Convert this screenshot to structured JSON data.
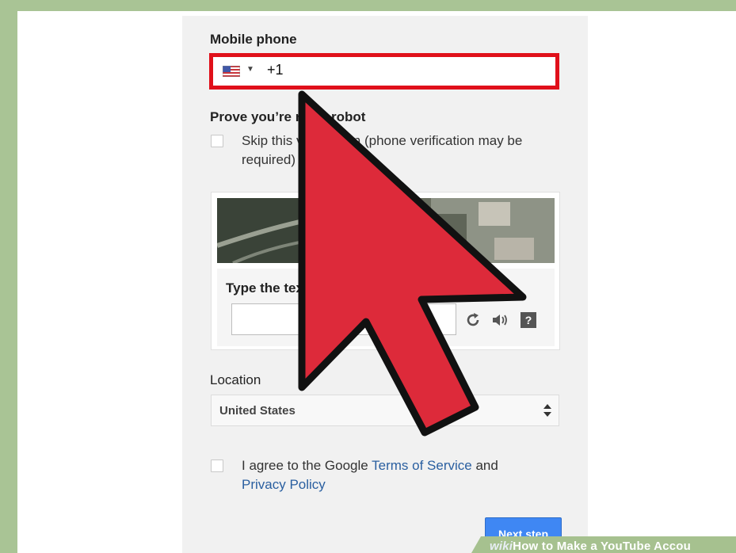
{
  "form": {
    "mobile_phone_label": "Mobile phone",
    "phone_value": "+1",
    "robot_heading": "Prove you’re not a robot",
    "skip_line1": "Skip this verification (phone verification may be",
    "skip_line2": "required)",
    "captcha_prompt": "Type the text:",
    "location_label": "Location",
    "location_value": "United States",
    "agree_prefix": "I agree to the Google ",
    "terms_link": "Terms of Service",
    "agree_and": " and",
    "privacy_link": "Privacy Policy",
    "next_button": "Next step"
  },
  "icons": {
    "flag": "us-flag-icon",
    "dropdown": "caret-down-icon",
    "refresh": "refresh-icon",
    "audio": "speaker-icon",
    "help": "question-icon",
    "select": "up-down-arrows-icon",
    "cursor": "mouse-pointer-arrow"
  },
  "watermark": {
    "brand": "wiki",
    "text": "How to Make a YouTube Accou"
  },
  "colors": {
    "highlight_border": "#e0101a",
    "cursor_fill": "#dd2a3a",
    "link": "#2a5fa0",
    "button": "#3f87f3"
  }
}
